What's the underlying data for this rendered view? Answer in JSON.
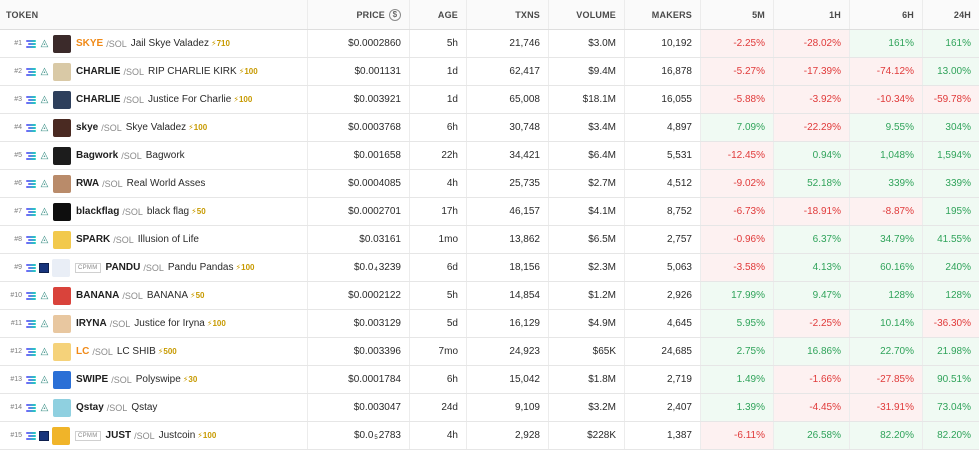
{
  "header": {
    "token": "TOKEN",
    "price": "PRICE",
    "age": "AGE",
    "txns": "TXNS",
    "volume": "VOLUME",
    "makers": "MAKERS",
    "m5": "5M",
    "h1": "1H",
    "h6": "6H",
    "h24": "24H",
    "price_icon": "$"
  },
  "icons": {
    "chain": "solana-icon",
    "dex": "raydium-icon",
    "boost": "lightning-icon",
    "cpmm": "cpmm-square-icon"
  },
  "colors": {
    "positive": "#2fa35a",
    "negative": "#e03a3a",
    "symbol_highlight": "#f08a18",
    "boost": "#c79a00"
  },
  "rows": [
    {
      "rank": "#1",
      "sym": "SKYE",
      "pair": "/SOL",
      "name": "Jail Skye Valadez",
      "boost": "⚡710",
      "price": "$0.0002860",
      "age": "5h",
      "txns": "21,746",
      "volume": "$3.0M",
      "makers": "10,192",
      "m5": "-2.25%",
      "h1": "-28.02%",
      "h6": "161%",
      "h24": "161%",
      "avatar_color": "#3b2a2a"
    },
    {
      "rank": "#2",
      "sym": "CHARLIE",
      "pair": "/SOL",
      "name": "RIP CHARLIE KIRK",
      "boost": "⚡100",
      "price": "$0.001131",
      "age": "1d",
      "txns": "62,417",
      "volume": "$9.4M",
      "makers": "16,878",
      "m5": "-5.27%",
      "h1": "-17.39%",
      "h6": "-74.12%",
      "h24": "13.00%",
      "avatar_color": "#d9c9a6"
    },
    {
      "rank": "#3",
      "sym": "CHARLIE",
      "pair": "/SOL",
      "name": "Justice For Charlie",
      "boost": "⚡100",
      "price": "$0.003921",
      "age": "1d",
      "txns": "65,008",
      "volume": "$18.1M",
      "makers": "16,055",
      "m5": "-5.88%",
      "h1": "-3.92%",
      "h6": "-10.34%",
      "h24": "-59.78%",
      "avatar_color": "#2e3f5c"
    },
    {
      "rank": "#4",
      "sym": "skye",
      "pair": "/SOL",
      "name": "Skye Valadez",
      "boost": "⚡100",
      "price": "$0.0003768",
      "age": "6h",
      "txns": "30,748",
      "volume": "$3.4M",
      "makers": "4,897",
      "m5": "7.09%",
      "h1": "-22.29%",
      "h6": "9.55%",
      "h24": "304%",
      "avatar_color": "#4a2a22"
    },
    {
      "rank": "#5",
      "sym": "Bagwork",
      "pair": "/SOL",
      "name": "Bagwork",
      "boost": "",
      "price": "$0.001658",
      "age": "22h",
      "txns": "34,421",
      "volume": "$6.4M",
      "makers": "5,531",
      "m5": "-12.45%",
      "h1": "0.94%",
      "h6": "1,048%",
      "h24": "1,594%",
      "avatar_color": "#1c1c1c"
    },
    {
      "rank": "#6",
      "sym": "RWA",
      "pair": "/SOL",
      "name": "Real World Asses",
      "boost": "",
      "price": "$0.0004085",
      "age": "4h",
      "txns": "25,735",
      "volume": "$2.7M",
      "makers": "4,512",
      "m5": "-9.02%",
      "h1": "52.18%",
      "h6": "339%",
      "h24": "339%",
      "avatar_color": "#b98b6a"
    },
    {
      "rank": "#7",
      "sym": "blackflag",
      "pair": "/SOL",
      "name": "black flag",
      "boost": "⚡50",
      "price": "$0.0002701",
      "age": "17h",
      "txns": "46,157",
      "volume": "$4.1M",
      "makers": "8,752",
      "m5": "-6.73%",
      "h1": "-18.91%",
      "h6": "-8.87%",
      "h24": "195%",
      "avatar_color": "#0e0e0e"
    },
    {
      "rank": "#8",
      "sym": "SPARK",
      "pair": "/SOL",
      "name": "Illusion of Life",
      "boost": "",
      "price": "$0.03161",
      "age": "1mo",
      "txns": "13,862",
      "volume": "$6.5M",
      "makers": "2,757",
      "m5": "-0.96%",
      "h1": "6.37%",
      "h6": "34.79%",
      "h24": "41.55%",
      "avatar_color": "#f2c94c"
    },
    {
      "rank": "#9",
      "sym": "PANDU",
      "pair": "/SOL",
      "name": "Pandu Pandas",
      "boost": "⚡100",
      "price_pre": "$0.0",
      "price_sub": "4",
      "price_post": "3239",
      "age": "6d",
      "txns": "18,156",
      "volume": "$2.3M",
      "makers": "5,063",
      "m5": "-3.58%",
      "h1": "4.13%",
      "h6": "60.16%",
      "h24": "240%",
      "avatar_color": "#e9eef6",
      "cpmm": "CPMM"
    },
    {
      "rank": "#10",
      "sym": "BANANA",
      "pair": "/SOL",
      "name": "BANANA",
      "boost": "⚡50",
      "price": "$0.0002122",
      "age": "5h",
      "txns": "14,854",
      "volume": "$1.2M",
      "makers": "2,926",
      "m5": "17.99%",
      "h1": "9.47%",
      "h6": "128%",
      "h24": "128%",
      "avatar_color": "#d9433b"
    },
    {
      "rank": "#11",
      "sym": "IRYNA",
      "pair": "/SOL",
      "name": "Justice for Iryna",
      "boost": "⚡100",
      "price": "$0.003129",
      "age": "5d",
      "txns": "16,129",
      "volume": "$4.9M",
      "makers": "4,645",
      "m5": "5.95%",
      "h1": "-2.25%",
      "h6": "10.14%",
      "h24": "-36.30%",
      "avatar_color": "#e8c7a0"
    },
    {
      "rank": "#12",
      "sym": "LC",
      "pair": "/SOL",
      "name": "LC SHIB",
      "boost": "⚡500",
      "price": "$0.003396",
      "age": "7mo",
      "txns": "24,923",
      "volume": "$65K",
      "makers": "24,685",
      "m5": "2.75%",
      "h1": "16.86%",
      "h6": "22.70%",
      "h24": "21.98%",
      "avatar_color": "#f5d27a",
      "sym_orange": true
    },
    {
      "rank": "#13",
      "sym": "SWIPE",
      "pair": "/SOL",
      "name": "Polyswipe",
      "boost": "⚡30",
      "price": "$0.0001784",
      "age": "6h",
      "txns": "15,042",
      "volume": "$1.8M",
      "makers": "2,719",
      "m5": "1.49%",
      "h1": "-1.66%",
      "h6": "-27.85%",
      "h24": "90.51%",
      "avatar_color": "#2a6fd6"
    },
    {
      "rank": "#14",
      "sym": "Qstay",
      "pair": "/SOL",
      "name": "Qstay",
      "boost": "",
      "price": "$0.003047",
      "age": "24d",
      "txns": "9,109",
      "volume": "$3.2M",
      "makers": "2,407",
      "m5": "1.39%",
      "h1": "-4.45%",
      "h6": "-31.91%",
      "h24": "73.04%",
      "avatar_color": "#8fd0e0"
    },
    {
      "rank": "#15",
      "sym": "JUST",
      "pair": "/SOL",
      "name": "Justcoin",
      "boost": "⚡100",
      "price_pre": "$0.0",
      "price_sub": "5",
      "price_post": "2783",
      "age": "4h",
      "txns": "2,928",
      "volume": "$228K",
      "makers": "1,387",
      "m5": "-6.11%",
      "h1": "26.58%",
      "h6": "82.20%",
      "h24": "82.20%",
      "avatar_color": "#f0b429",
      "cpmm": "CPMM"
    }
  ]
}
